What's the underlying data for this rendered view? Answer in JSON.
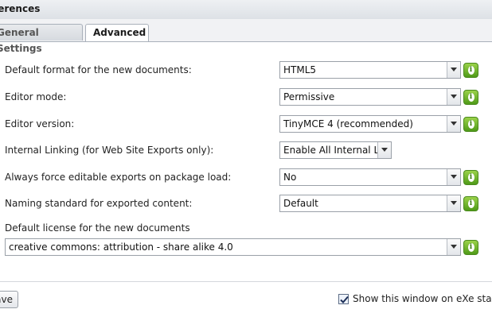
{
  "window": {
    "title": "ferences"
  },
  "tabs": [
    {
      "label": "General Settings",
      "active": false
    },
    {
      "label": "Advanced",
      "active": true
    }
  ],
  "settings": [
    {
      "label": "Default format for the new documents:",
      "value": "HTML5"
    },
    {
      "label": "Editor mode:",
      "value": "Permissive"
    },
    {
      "label": "Editor version:",
      "value": "TinyMCE 4 (recommended)"
    },
    {
      "label": "Internal Linking (for Web Site Exports only):",
      "value": "Enable All Internal Li"
    },
    {
      "label": "Always force editable exports on package load:",
      "value": "No"
    },
    {
      "label": "Naming standard for exported content:",
      "value": "Default"
    }
  ],
  "license": {
    "label": "Default license for the new documents",
    "value": "creative commons: attribution - share alike 4.0"
  },
  "footer": {
    "save_label": "ave",
    "show_window_label": "Show this window on eXe star",
    "show_window_checked": true
  },
  "colors": {
    "info_button": "#5ca820",
    "tab_border": "#a9b0ba",
    "select_border": "#9aa0a8"
  }
}
